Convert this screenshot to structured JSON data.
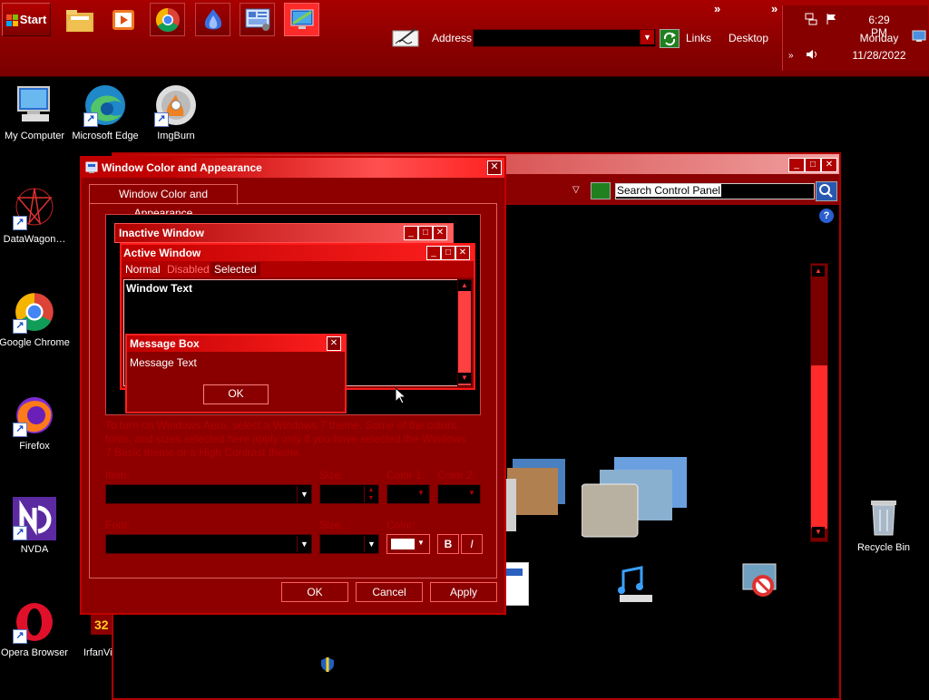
{
  "taskbar": {
    "start_label": "Start",
    "address_label": "Address",
    "address_value": "",
    "links_label": "Links",
    "desktop_label": "Desktop",
    "overflow_glyph": "»",
    "clock": {
      "time": "6:29 PM",
      "day": "Monday",
      "date": "11/28/2022"
    }
  },
  "desktop": {
    "icons": [
      {
        "label": "My Computer"
      },
      {
        "label": "Microsoft Edge"
      },
      {
        "label": "ImgBurn"
      },
      {
        "label": "DataWagon…"
      },
      {
        "label": "Google Chrome"
      },
      {
        "label": "Firefox"
      },
      {
        "label": "NVDA"
      },
      {
        "label": "Opera Browser"
      },
      {
        "label": "IrfanVi"
      },
      {
        "label": "Recycle Bin"
      }
    ]
  },
  "control_panel": {
    "search_placeholder": "Search Control Panel"
  },
  "dialog": {
    "title": "Window Color and Appearance",
    "tab_label": "Window Color and Appearance",
    "preview": {
      "inactive_title": "Inactive Window",
      "active_title": "Active Window",
      "menu_normal": "Normal",
      "menu_disabled": "Disabled",
      "menu_selected": "Selected",
      "window_text": "Window Text",
      "msgbox_title": "Message Box",
      "msgbox_text": "Message Text",
      "msgbox_ok": "OK"
    },
    "info_text": "To turn on Windows Aero, select a Windows 7 theme. Some of the colors, fonts, and sizes selected here apply only if you have selected the Windows 7 Basic theme or a High Contrast theme.",
    "labels": {
      "item": "Item:",
      "size1": "Size:",
      "color1": "Color 1:",
      "color2": "Color 2:",
      "font": "Font:",
      "size2": "Size:",
      "color": "Color:",
      "bold": "B",
      "italic": "I"
    },
    "buttons": {
      "ok": "OK",
      "cancel": "Cancel",
      "apply": "Apply"
    }
  }
}
